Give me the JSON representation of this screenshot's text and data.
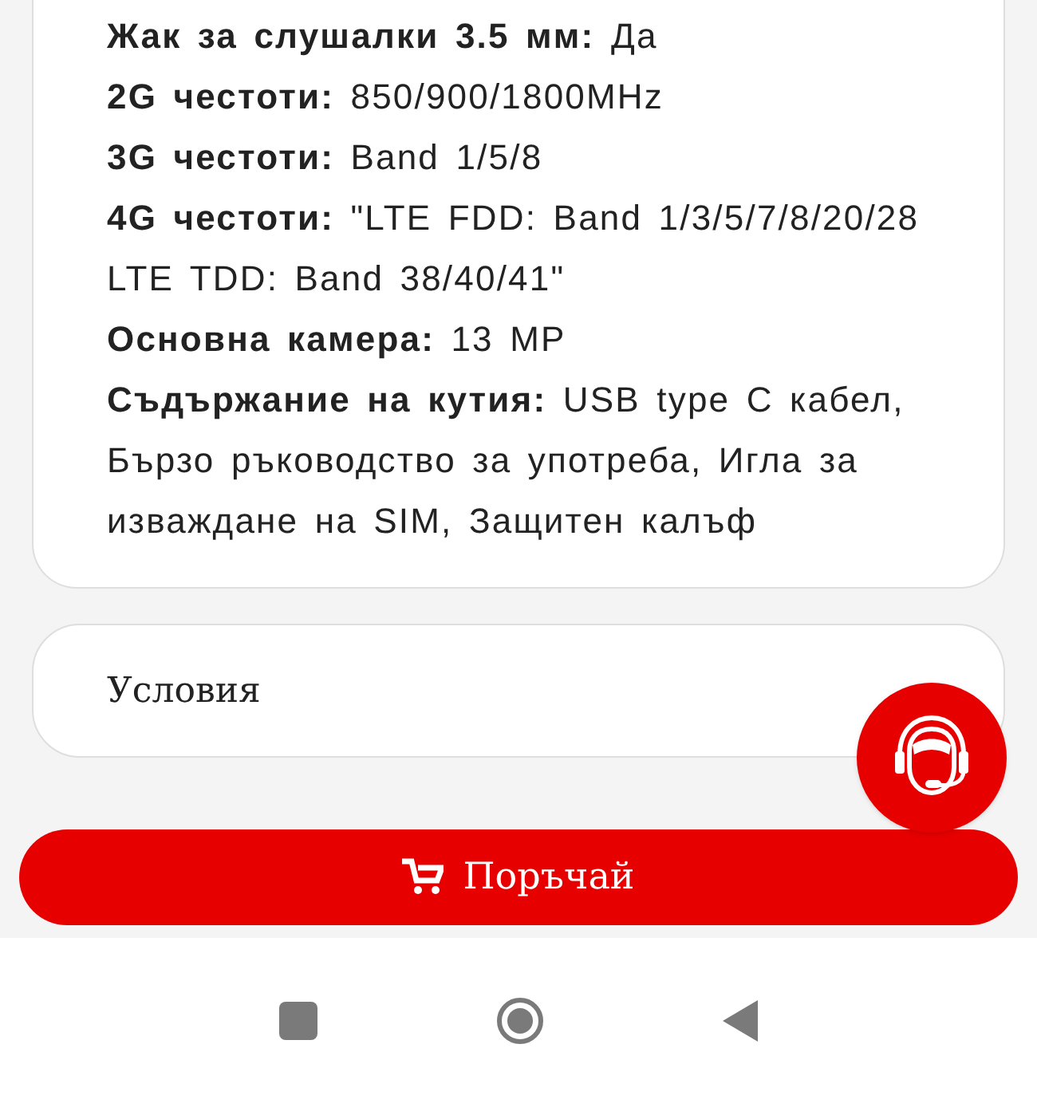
{
  "specs": [
    {
      "text": "**Жак за слушалки 3.5 мм:** Да"
    },
    {
      "text": "**2G честоти:** 850/900/1800MHz"
    },
    {
      "text": "**3G честоти:** Band 1/5/8"
    },
    {
      "text": "**4G честоти:** \"LTE FDD: Band 1/3/5/7/8/20/28 LTE TDD: Band 38/40/41\""
    },
    {
      "text": "**Основна камера:** 13 MP"
    },
    {
      "text": "**Съдържание на кутия:** USB type C кабел, Бързо ръководство за употреба, Игла за изваждане на SIM, Защитен калъф"
    }
  ],
  "conditions": {
    "title": "Условия"
  },
  "order_button": {
    "label": "Поръчай"
  },
  "nav_buttons": [
    {
      "kind": "recents"
    },
    {
      "kind": "home"
    },
    {
      "kind": "back"
    }
  ]
}
